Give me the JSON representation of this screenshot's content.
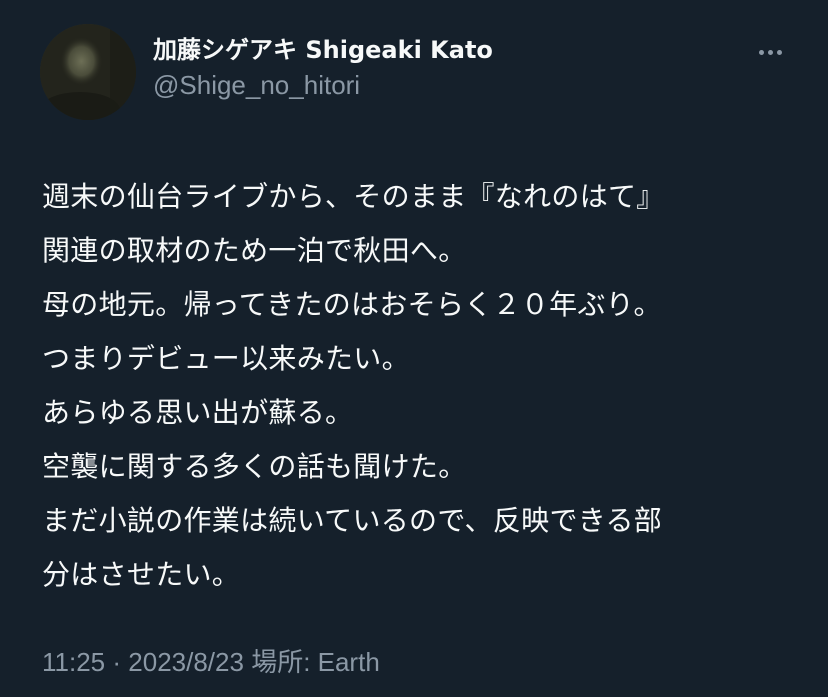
{
  "author": {
    "display_name": "加藤シゲアキ Shigeaki Kato",
    "handle": "@Shige_no_hitori",
    "avatar": "profile-photo"
  },
  "more_icon": "more-horizontal-icon",
  "tweet": {
    "lines": [
      "週末の仙台ライブから、そのまま『なれのはて』",
      "関連の取材のため一泊で秋田へ。",
      "母の地元。帰ってきたのはおそらく２０年ぶり。",
      "つまりデビュー以来みたい。",
      "あらゆる思い出が蘇る。",
      "空襲に関する多くの話も聞けた。",
      "まだ小説の作業は続いているので、反映できる部",
      "分はさせたい。"
    ]
  },
  "meta": {
    "time": "11:25",
    "separator": "·",
    "date": "2023/8/23",
    "location": "場所: Earth"
  },
  "colors": {
    "background": "#15202b",
    "primary_text": "#f7f9f9",
    "secondary_text": "#8b98a5"
  }
}
